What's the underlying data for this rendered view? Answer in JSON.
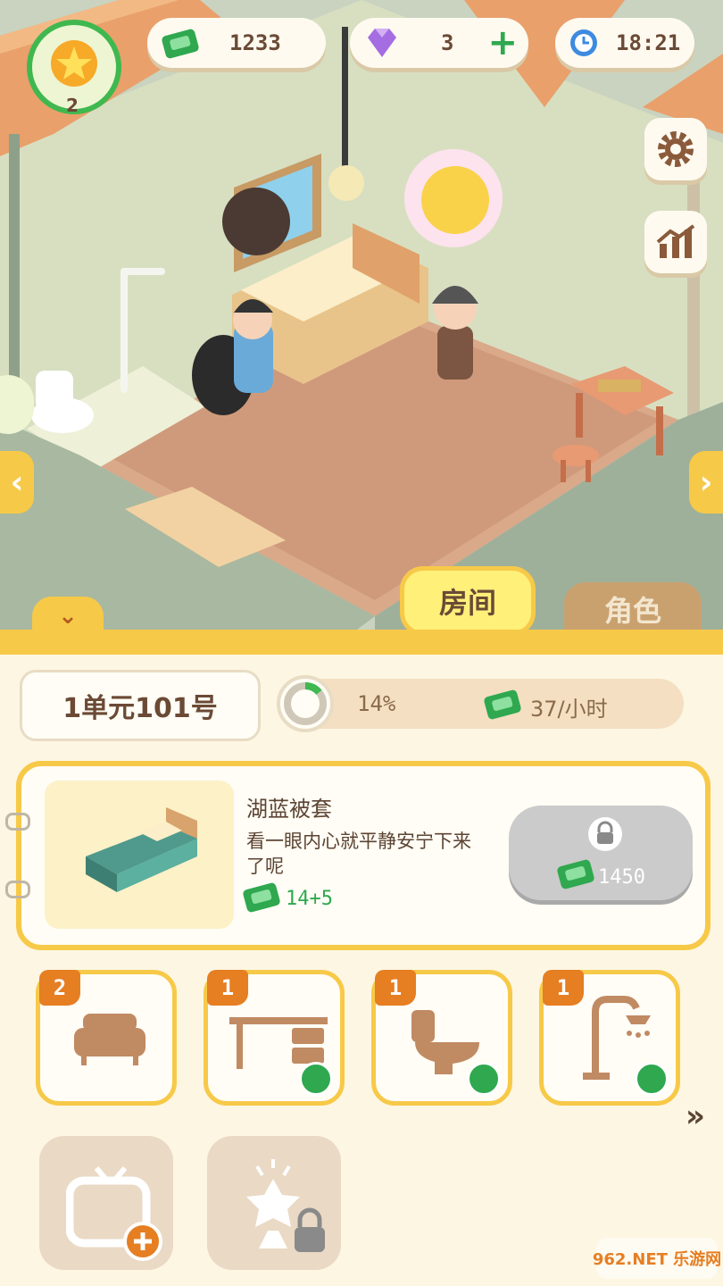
{
  "hud": {
    "level": "2",
    "cash": "1233",
    "gems": "3",
    "time": "18:21"
  },
  "tabs": {
    "room": "房间",
    "character": "角色"
  },
  "room_info": {
    "name": "1单元101号",
    "progress_percent": 14,
    "progress_label": "14%",
    "income_rate": "37/小时"
  },
  "selected_item": {
    "name": "湖蓝被套",
    "description": "看一眼内心就平静安宁下来了呢",
    "income_bonus": "14+5",
    "price": "1450",
    "locked": true
  },
  "furniture_slots": [
    {
      "icon": "bed-icon",
      "count": "2",
      "upgrade": false
    },
    {
      "icon": "desk-icon",
      "count": "1",
      "upgrade": true
    },
    {
      "icon": "toilet-icon",
      "count": "1",
      "upgrade": true
    },
    {
      "icon": "shower-icon",
      "count": "1",
      "upgrade": true
    }
  ],
  "extra_slots": [
    {
      "icon": "tv-add-icon"
    },
    {
      "icon": "lamp-locked-icon"
    }
  ],
  "watermark": "962.NET 乐游网",
  "colors": {
    "accent_yellow": "#f7c948",
    "cash_green": "#2fa84f",
    "gem_purple": "#a56de2",
    "brown_text": "#6b4a35",
    "tab_inactive": "#c9a16f"
  }
}
